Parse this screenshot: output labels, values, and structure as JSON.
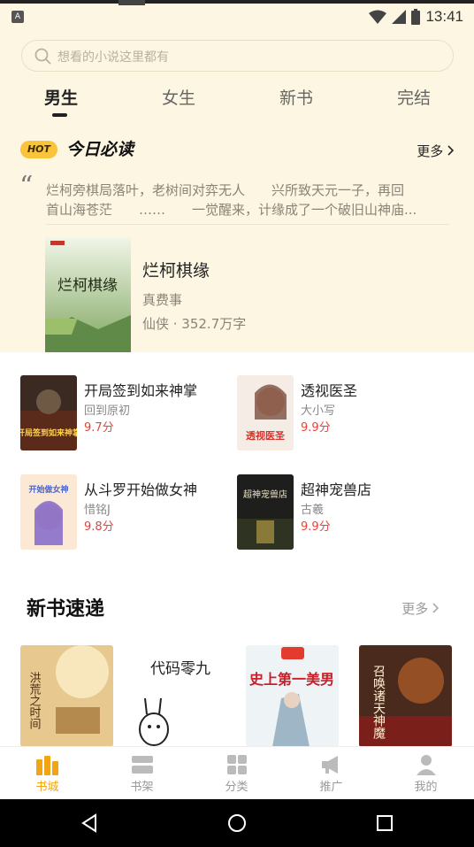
{
  "status_bar": {
    "time": "13:41",
    "left_icon_label": "A"
  },
  "search": {
    "placeholder": "想看的小说这里都有"
  },
  "tabs": [
    {
      "label": "男生",
      "active": true
    },
    {
      "label": "女生",
      "active": false
    },
    {
      "label": "新书",
      "active": false
    },
    {
      "label": "完结",
      "active": false
    }
  ],
  "daily": {
    "badge": "HOT",
    "title": "今日必读",
    "more": "更多",
    "quote_line1": "烂柯旁棋局落叶，老树间对弈无人　　兴所致天元一子，再回",
    "quote_line2": "首山海苍茫　　……　　一觉醒来，计缘成了一个破旧山神庙...",
    "feature": {
      "title": "烂柯棋缘",
      "author": "真费事",
      "meta": "仙侠 · 352.7万字",
      "cover_text": "烂柯棋缘"
    }
  },
  "grid": [
    {
      "title": "开局签到如来神掌",
      "author": "回到原初",
      "score": "9.7分",
      "cover_text": "开局签到如来神掌"
    },
    {
      "title": "透视医圣",
      "author": "大小写",
      "score": "9.9分",
      "cover_text": "透视医圣"
    },
    {
      "title": "从斗罗开始做女神",
      "author": "惜铭J",
      "score": "9.8分",
      "cover_text": "开始做女神"
    },
    {
      "title": "超神宠兽店",
      "author": "古羲",
      "score": "9.9分",
      "cover_text": "超神宠兽店"
    }
  ],
  "new_books": {
    "title": "新书速递",
    "more": "更多",
    "covers": [
      {
        "cover_text": "洪荒之时间"
      },
      {
        "cover_text": "代码零九"
      },
      {
        "cover_text": "史上第一美男"
      },
      {
        "cover_text": "召唤诸天神魔"
      }
    ]
  },
  "bottom_nav": [
    {
      "label": "书城",
      "icon": "bookstore-icon",
      "active": true
    },
    {
      "label": "书架",
      "icon": "bookshelf-icon",
      "active": false
    },
    {
      "label": "分类",
      "icon": "category-icon",
      "active": false
    },
    {
      "label": "推广",
      "icon": "megaphone-icon",
      "active": false
    },
    {
      "label": "我的",
      "icon": "profile-icon",
      "active": false
    }
  ],
  "colors": {
    "accent": "#f0a613",
    "cream": "#fdf6e3",
    "score": "#e0463c"
  }
}
